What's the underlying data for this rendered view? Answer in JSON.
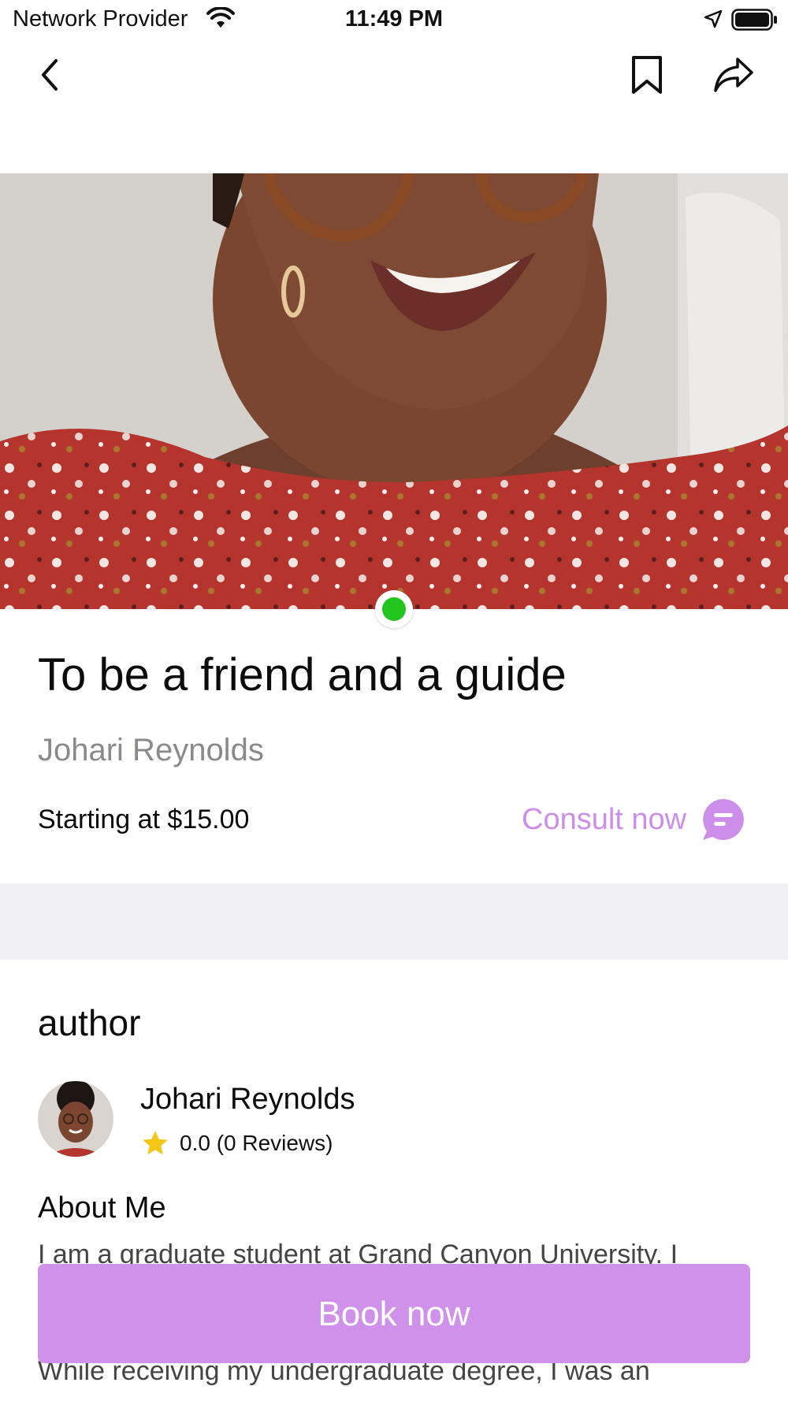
{
  "status_bar": {
    "carrier": "Network Provider",
    "time": "11:49 PM",
    "icons": [
      "wifi-icon",
      "location-arrow-icon",
      "battery-icon"
    ]
  },
  "nav": {
    "icons": [
      "chevron-left-icon",
      "bookmark-icon",
      "share-icon"
    ]
  },
  "hero": {
    "online_status_color": "#22c51e"
  },
  "listing": {
    "title": "To be a friend and a guide",
    "author_name": "Johari Reynolds",
    "price": "Starting at $15.00",
    "consult_label": "Consult now"
  },
  "author_section": {
    "heading": "author",
    "name": "Johari Reynolds",
    "rating": "0.0 (0 Reviews)",
    "about_heading": "About Me",
    "about_lines": [
      "I am a graduate student at Grand Canyon University. I",
      "While receiving my undergraduate degree, I was an"
    ]
  },
  "footer": {
    "book_label": "Book now"
  },
  "colors": {
    "accent": "#d091ea",
    "consult_text": "#cc8ee8",
    "star": "#f5c518",
    "divider_band": "#f1f1f5"
  }
}
